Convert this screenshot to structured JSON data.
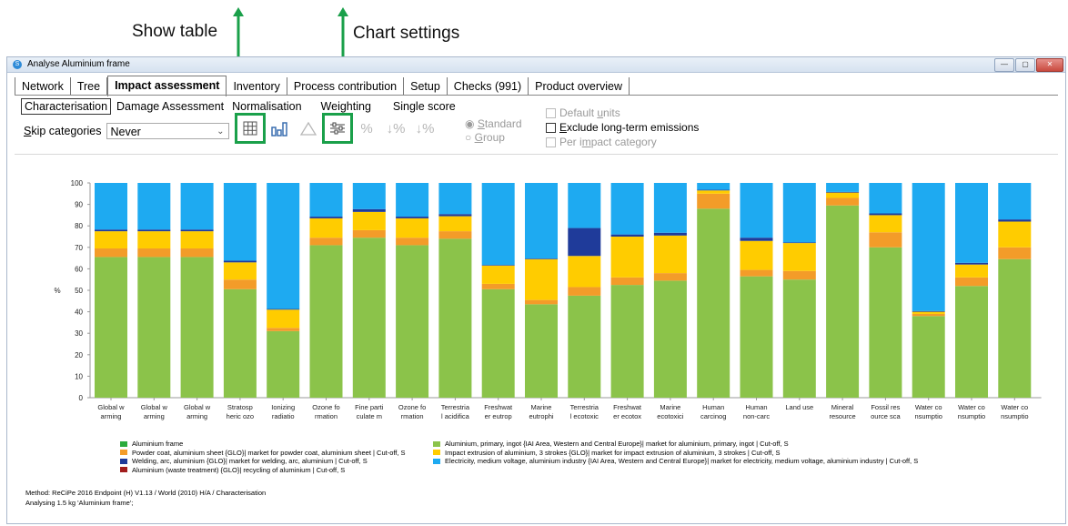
{
  "annotations": {
    "show_table": "Show table",
    "chart_settings": "Chart settings",
    "highlight_color": "#1aa04a"
  },
  "window": {
    "title": "Analyse Aluminium frame"
  },
  "tabs": [
    {
      "label": "Network"
    },
    {
      "label": "Tree"
    },
    {
      "label": "Impact assessment"
    },
    {
      "label": "Inventory"
    },
    {
      "label": "Process contribution"
    },
    {
      "label": "Setup"
    },
    {
      "label": "Checks (991)"
    },
    {
      "label": "Product overview"
    }
  ],
  "subtabs": [
    {
      "label": "Characterisation"
    },
    {
      "label": "Damage Assessment"
    },
    {
      "label": "Normalisation"
    },
    {
      "label": "Weighting"
    },
    {
      "label": "Single score"
    }
  ],
  "skip": {
    "label_pre": "",
    "label_u": "S",
    "label_post": "kip categories",
    "value": "Never"
  },
  "toolbar": {
    "icons": [
      "table-icon",
      "bar-chart-icon",
      "triangle-icon",
      "chart-settings-icon",
      "percent-icon",
      "sort-down-icon",
      "sort-percent-icon"
    ]
  },
  "radios": {
    "standard_u": "S",
    "standard_rest": "tandard",
    "group_u": "G",
    "group_rest": "roup"
  },
  "checks": {
    "default_units_pre": "Default ",
    "default_units_u": "u",
    "default_units_post": "nits",
    "exclude_u": "E",
    "exclude_rest": "xclude long-term emissions",
    "per_impact_pre": "Per i",
    "per_impact_u": "m",
    "per_impact_post": "pact category"
  },
  "chart_data": {
    "type": "bar",
    "stacked": true,
    "ylabel": "%",
    "ylim": [
      0,
      100
    ],
    "yticks": [
      0,
      10,
      20,
      30,
      40,
      50,
      60,
      70,
      80,
      90,
      100
    ],
    "categories": [
      [
        "Global w",
        "arming"
      ],
      [
        "Global w",
        "arming"
      ],
      [
        "Global w",
        "arming"
      ],
      [
        "Stratosp",
        "heric ozo"
      ],
      [
        "Ionizing",
        "radiatio"
      ],
      [
        "Ozone fo",
        "rmation"
      ],
      [
        "Fine parti",
        "culate m"
      ],
      [
        "Ozone fo",
        "rmation"
      ],
      [
        "Terrestria",
        "l acidifica"
      ],
      [
        "Freshwat",
        "er eutrop"
      ],
      [
        "Marine",
        "eutrophi"
      ],
      [
        "Terrestria",
        "l ecotoxic"
      ],
      [
        "Freshwat",
        "er ecotox"
      ],
      [
        "Marine",
        "ecotoxici"
      ],
      [
        "Human",
        "carcinog"
      ],
      [
        "Human",
        "non-carc"
      ],
      [
        "Land use",
        ""
      ],
      [
        "Mineral",
        "resource"
      ],
      [
        "Fossil res",
        "ource sca"
      ],
      [
        "Water co",
        "nsumptio"
      ],
      [
        "Water co",
        "nsumptio"
      ],
      [
        "Water co",
        "nsumptio"
      ]
    ],
    "series": [
      {
        "name": "Aluminium, primary, ingot {IAI Area, Western and Central Europe}| market for aluminium, primary, ingot | Cut-off, S",
        "color": "#8bc34a",
        "values": [
          65.5,
          65.5,
          65.5,
          50.5,
          31,
          71,
          74.5,
          71,
          74,
          50.5,
          43.5,
          47.5,
          52.5,
          54.5,
          88,
          56.5,
          55,
          89.5,
          70,
          38,
          52,
          64.5
        ]
      },
      {
        "name": "Powder coat, aluminium sheet {GLO}| market for powder coat, aluminium sheet | Cut-off, S",
        "color": "#f39c29",
        "values": [
          4,
          4,
          4,
          4.5,
          1.5,
          3.5,
          3.5,
          3.5,
          3.5,
          2.5,
          2,
          4,
          3.5,
          3.5,
          7,
          3,
          4,
          3.5,
          7,
          1,
          4,
          5.5
        ]
      },
      {
        "name": "Impact extrusion of aluminium, 3 strokes {GLO}| market for impact extrusion of aluminium, 3 strokes | Cut-off, S",
        "color": "#ffcc00",
        "values": [
          8,
          8,
          8,
          8,
          8.5,
          9,
          8.5,
          9,
          7,
          8.5,
          19,
          14.5,
          19,
          17.5,
          1.5,
          13.5,
          13,
          2.5,
          8,
          1,
          6,
          12
        ]
      },
      {
        "name": "Welding, arc, aluminium {GLO}| market for welding, arc, aluminium | Cut-off, S",
        "color": "#1f3b9a",
        "values": [
          0.8,
          0.8,
          0.8,
          0.8,
          0.3,
          0.8,
          1.3,
          0.8,
          1,
          0.3,
          0.3,
          13,
          1,
          1.3,
          0.3,
          1.5,
          0.3,
          0.3,
          0.8,
          0.3,
          0.8,
          1
        ]
      },
      {
        "name": "Electricity, medium voltage, aluminium industry {IAI Area, Western and Central Europe}| market for electricity, medium voltage, aluminium industry | Cut-off, S",
        "color": "#1eaaf1",
        "values": [
          21.7,
          21.7,
          21.7,
          36.2,
          58.7,
          15.7,
          12.2,
          15.7,
          14.5,
          38.2,
          35.2,
          21,
          24,
          23.2,
          3.2,
          25.5,
          27.7,
          4.2,
          14.2,
          59.7,
          37.2,
          17
        ]
      },
      {
        "name": "Aluminium (waste treatment) {GLO}| recycling of aluminium | Cut-off, S",
        "color": "#a11d1d",
        "values": [
          0,
          0,
          0,
          0,
          0,
          0,
          0,
          0,
          0,
          0,
          0,
          0,
          0,
          0,
          0,
          0,
          0,
          0,
          0,
          0,
          0,
          0
        ]
      }
    ],
    "legend": {
      "left": [
        {
          "name": "Aluminium frame",
          "color": "#2bab3c"
        },
        {
          "name": "Powder coat, aluminium sheet {GLO}| market for powder coat, aluminium sheet | Cut-off, S",
          "color": "#f39c29"
        },
        {
          "name": "Welding, arc, aluminium {GLO}| market for welding, arc, aluminium | Cut-off, S",
          "color": "#1f3b9a"
        },
        {
          "name": "Aluminium (waste treatment) {GLO}| recycling of aluminium | Cut-off, S",
          "color": "#a11d1d"
        }
      ],
      "right": [
        {
          "name": "Aluminium, primary, ingot {IAI Area, Western and Central Europe}| market for aluminium, primary, ingot | Cut-off, S",
          "color": "#8bc34a"
        },
        {
          "name": "Impact extrusion of aluminium, 3 strokes {GLO}| market for impact extrusion of aluminium, 3 strokes | Cut-off, S",
          "color": "#ffcc00"
        },
        {
          "name": "Electricity, medium voltage, aluminium industry {IAI Area, Western and Central Europe}| market for electricity, medium voltage, aluminium industry | Cut-off, S",
          "color": "#1eaaf1"
        }
      ]
    }
  },
  "footer": {
    "method": "Method: ReCiPe 2016 Endpoint (H) V1.13 / World (2010) H/A / Characterisation",
    "analysing": "Analysing 1.5 kg 'Aluminium frame';"
  }
}
